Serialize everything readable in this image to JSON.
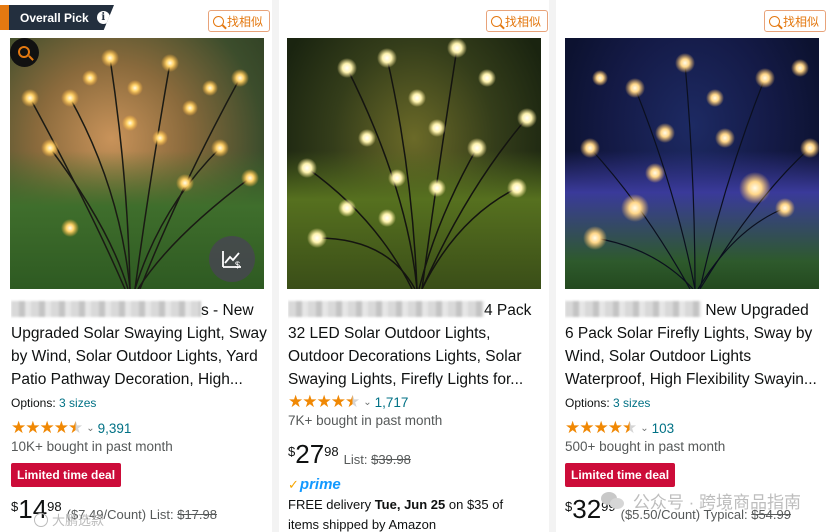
{
  "cards": [
    {
      "badge": "Overall Pick",
      "badge_info_icon": "info-icon",
      "similar_label": "找相似",
      "title": {
        "line1_suffix": "s - New",
        "line2": "Upgraded Solar Swaying Light, Sway",
        "line3": "by Wind, Solar Outdoor Lights, Yard",
        "line4": "Patio Pathway Decoration, High..."
      },
      "options_label": "Options:",
      "options_value": "3 sizes",
      "stars": 4.5,
      "rating_count": "9,391",
      "bought": "10K+ bought in past month",
      "deal": "Limited time deal",
      "price": {
        "symbol": "$",
        "whole": "14",
        "fraction": "98",
        "extra_unit": "($7.49/Count)",
        "list_label": "List:",
        "list_price": "$17.98"
      }
    },
    {
      "similar_label": "找相似",
      "title": {
        "line1_suffix": "4 Pack",
        "line2": "32 LED Solar Outdoor Lights,",
        "line3": "Outdoor Decorations Lights, Solar",
        "line4": "Swaying Lights, Firefly Lights for..."
      },
      "stars": 4.5,
      "rating_count": "1,717",
      "bought": "7K+ bought in past month",
      "price": {
        "symbol": "$",
        "whole": "27",
        "fraction": "98",
        "list_label": "List:",
        "list_price": "$39.98"
      },
      "prime": "prime",
      "delivery": {
        "prefix": "FREE delivery ",
        "date": "Tue, Jun 25",
        "middle": " on $35 of",
        "line2": "items shipped by Amazon"
      }
    },
    {
      "similar_label": "找相似",
      "title": {
        "line1_suffix": "New Upgraded",
        "line2": "6 Pack Solar Firefly Lights, Sway by",
        "line3": "Wind, Solar Outdoor Lights",
        "line4": "Waterproof, High Flexibility Swayin..."
      },
      "options_label": "Options:",
      "options_value": "3 sizes",
      "stars": 4.5,
      "rating_count": "103",
      "bought": "500+ bought in past month",
      "deal": "Limited time deal",
      "price": {
        "symbol": "$",
        "whole": "32",
        "fraction": "99",
        "extra_unit": "($5.50/Count)",
        "list_label": "Typical:",
        "list_price": "$54.99"
      }
    }
  ],
  "watermark": {
    "text": "公众号 · 跨境商品指南",
    "bottom_left": "大鹏选款"
  },
  "colors": {
    "accent": "#e47911",
    "link": "#007185",
    "deal": "#cc0c39",
    "star": "#f08804",
    "prime": "#1399ff"
  }
}
